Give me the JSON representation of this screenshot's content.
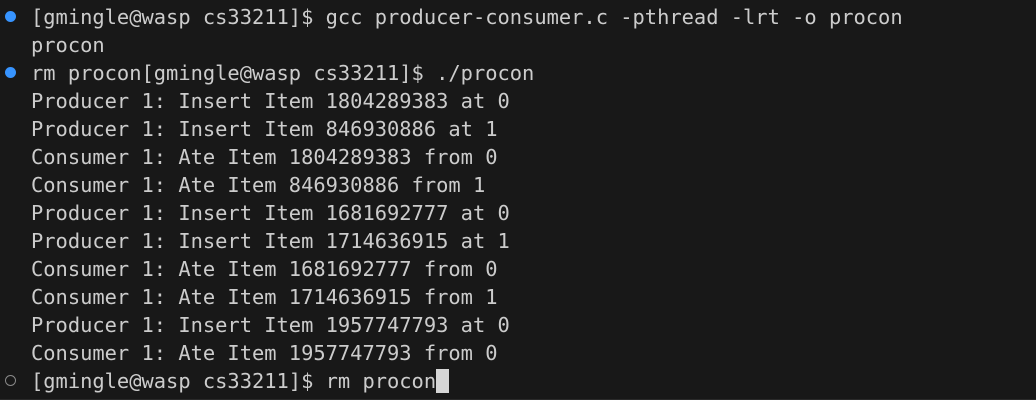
{
  "terminal": {
    "lines": [
      "[gmingle@wasp cs33211]$ gcc producer-consumer.c -pthread -lrt -o procon",
      "procon",
      "rm procon[gmingle@wasp cs33211]$ ./procon",
      "Producer 1: Insert Item 1804289383 at 0",
      "Producer 1: Insert Item 846930886 at 1",
      "Consumer 1: Ate Item 1804289383 from 0",
      "Consumer 1: Ate Item 846930886 from 1",
      "Producer 1: Insert Item 1681692777 at 0",
      "Producer 1: Insert Item 1714636915 at 1",
      "Consumer 1: Ate Item 1681692777 from 0",
      "Consumer 1: Ate Item 1714636915 from 1",
      "Producer 1: Insert Item 1957747793 at 0",
      "Consumer 1: Ate Item 1957747793 from 0",
      "[gmingle@wasp cs33211]$ rm procon"
    ],
    "markers": {
      "completed_icon": "filled-circle-icon",
      "pending_icon": "empty-circle-icon",
      "completed_color": "#3794ff",
      "pending_color": "#8a8a8a"
    },
    "colors": {
      "background": "#181818",
      "text": "#cccccc",
      "cursor": "#d6d6d6"
    }
  }
}
